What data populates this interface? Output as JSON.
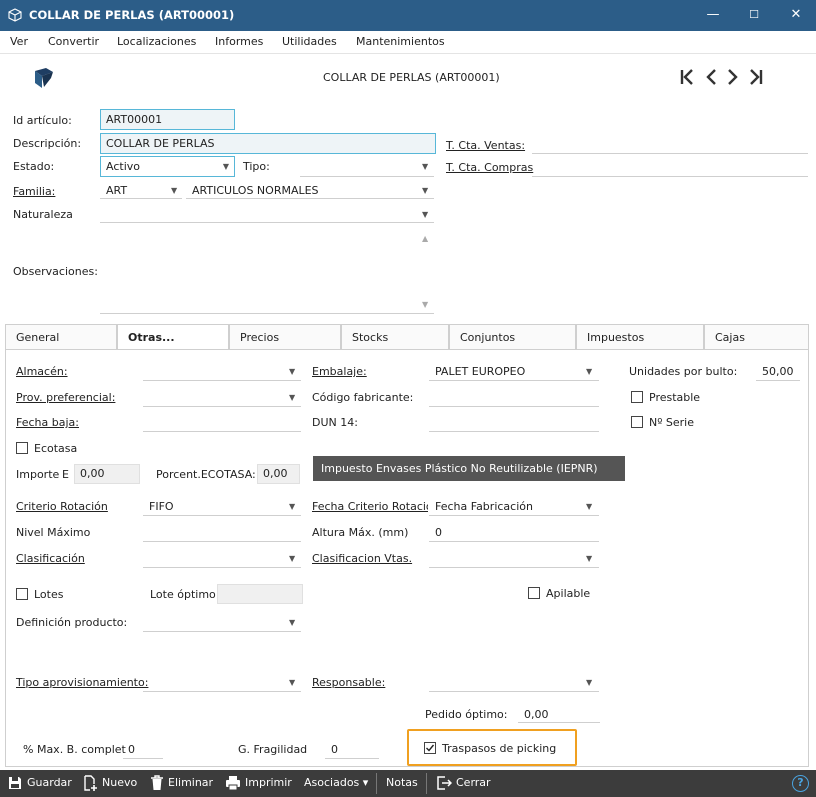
{
  "window": {
    "title": "COLLAR DE PERLAS (ART00001)",
    "min": "—",
    "max": "☐",
    "close": "✕"
  },
  "menu": [
    "Ver",
    "Convertir",
    "Localizaciones",
    "Informes",
    "Utilidades",
    "Mantenimientos"
  ],
  "header": {
    "title": "COLLAR DE PERLAS (ART00001)"
  },
  "form": {
    "id_label": "Id artículo:",
    "id_value": "ART00001",
    "desc_label": "Descripción:",
    "desc_value": "COLLAR DE PERLAS",
    "estado_label": "Estado:",
    "estado_value": "Activo",
    "tipo_label": "Tipo:",
    "tipo_value": "",
    "familia_label": "Familia:",
    "familia_code": "ART",
    "familia_name": "ARTICULOS NORMALES",
    "naturaleza_label": "Naturaleza",
    "observaciones_label": "Observaciones:",
    "cta_ventas_label": "T. Cta. Ventas:",
    "cta_compras_label": "T. Cta. Compras"
  },
  "tabs": [
    "General",
    "Otras...",
    "Precios",
    "Stocks",
    "Conjuntos",
    "Impuestos",
    "Cajas"
  ],
  "panel": {
    "almacen": "Almacén:",
    "embalaje": "Embalaje:",
    "embalaje_value": "PALET EUROPEO",
    "unidades": "Unidades por bulto:",
    "unidades_value": "50,00",
    "prov": "Prov. preferencial:",
    "codigo_fab": "Código fabricante:",
    "prestable": "Prestable",
    "fecha_baja": "Fecha baja:",
    "dun14": "DUN 14:",
    "nserie": "Nº Serie",
    "ecotasa": "Ecotasa",
    "importe": "Importe",
    "importe_e": "E",
    "importe_value": "0,00",
    "porcent": "Porcent.ECOTASA:",
    "porcent_value": "0,00",
    "iepnr_button": "Impuesto Envases Plástico No Reutilizable (IEPNR)",
    "criterio": "Criterio Rotación",
    "criterio_value": "FIFO",
    "fecha_criterio": "Fecha Criterio Rotació",
    "fecha_criterio_value": "Fecha Fabricación",
    "nivel_max": "Nivel Máximo",
    "altura_max": "Altura Máx. (mm)",
    "altura_value": "0",
    "clasificacion": "Clasificación",
    "clasificacion_vtas": "Clasificacion Vtas.",
    "lotes": "Lotes",
    "lote_optimo": "Lote óptimo",
    "apilable": "Apilable",
    "definicion": "Definición producto:",
    "tipo_aprov": "Tipo aprovisionamiento:",
    "responsable": "Responsable:",
    "pedido_optimo": "Pedido óptimo:",
    "pedido_value": "0,00",
    "max_b": "% Max. B. complet",
    "max_b_value": "0",
    "fragilidad": "G. Fragilidad",
    "fragilidad_value": "0",
    "traspasos": "Traspasos de picking"
  },
  "toolbar": {
    "guardar": "Guardar",
    "nuevo": "Nuevo",
    "eliminar": "Eliminar",
    "imprimir": "Imprimir",
    "asociados": "Asociados ▾",
    "notas": "Notas",
    "cerrar": "Cerrar",
    "help": "?"
  },
  "colors": {
    "titlebar": "#2c5d88",
    "bottombar": "#3c3c3c",
    "highlight": "#f0a020"
  }
}
